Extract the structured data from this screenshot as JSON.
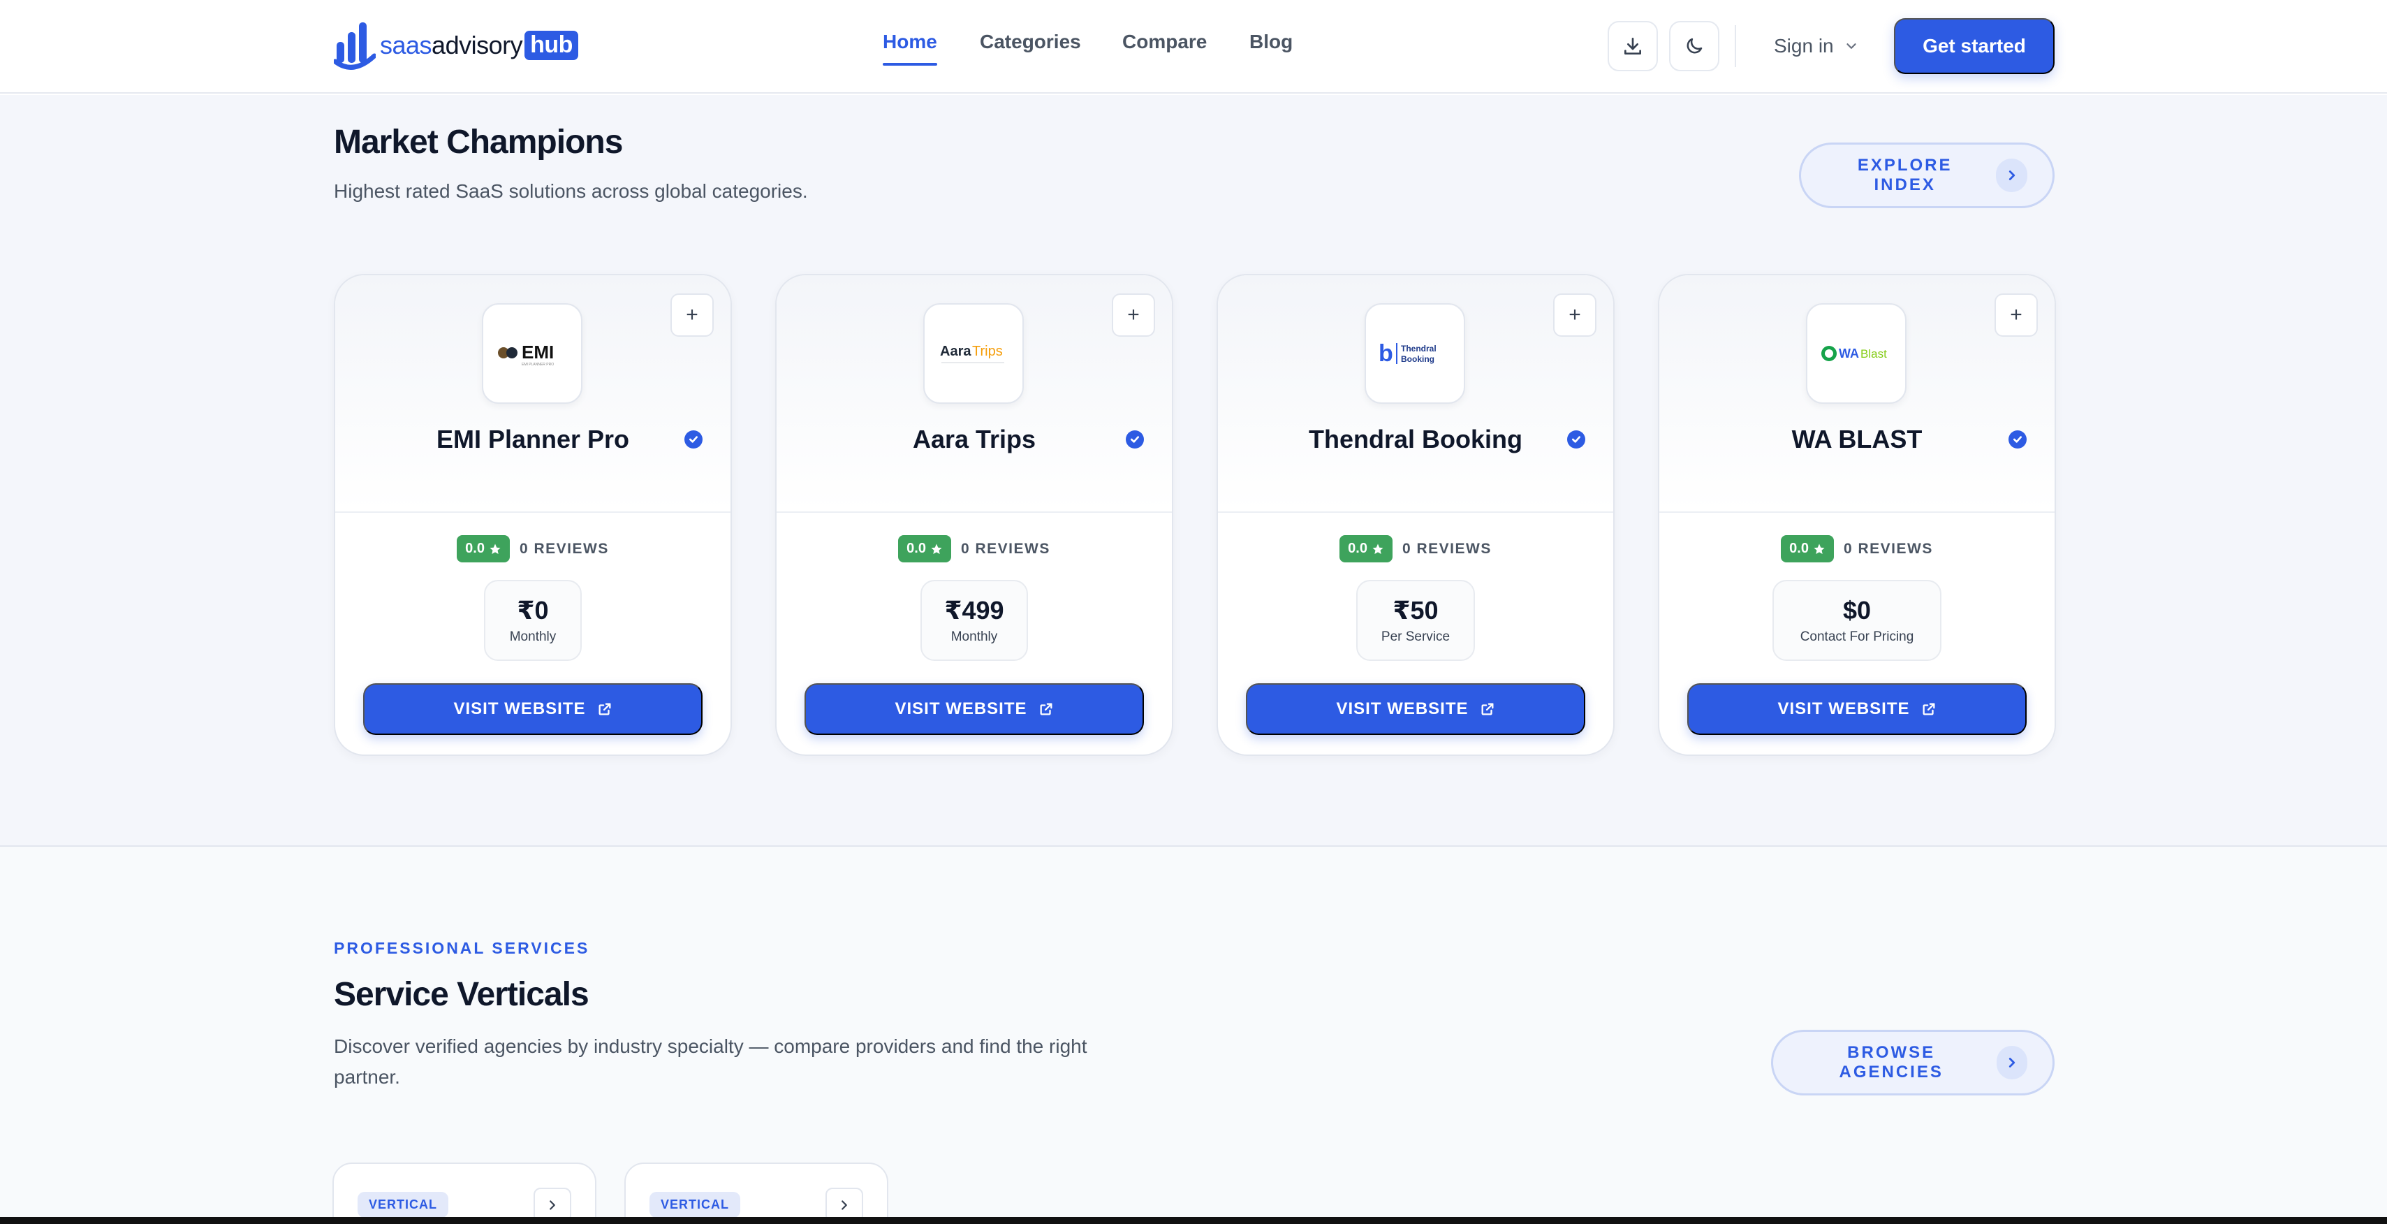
{
  "brand": {
    "part1": "saas",
    "part2": "advisory",
    "part3": "hub"
  },
  "nav": {
    "links": [
      {
        "label": "Home",
        "active": true
      },
      {
        "label": "Categories",
        "active": false
      },
      {
        "label": "Compare",
        "active": false
      },
      {
        "label": "Blog",
        "active": false
      }
    ],
    "signin": "Sign in",
    "cta": "Get started",
    "icons": [
      "download-icon",
      "moon-icon",
      "chevron-down-icon"
    ]
  },
  "champions": {
    "title": "Market Champions",
    "subtitle": "Highest rated SaaS solutions across global categories.",
    "explore": "EXPLORE INDEX",
    "cards": [
      {
        "name": "EMI Planner Pro",
        "logo_text": "EMI",
        "rating": "0.0",
        "reviews": "0 REVIEWS",
        "price": "₹0",
        "unit": "Monthly",
        "cta": "VISIT WEBSITE"
      },
      {
        "name": "Aara Trips",
        "logo_text": "Aara Trips",
        "rating": "0.0",
        "reviews": "0 REVIEWS",
        "price": "₹499",
        "unit": "Monthly",
        "cta": "VISIT WEBSITE"
      },
      {
        "name": "Thendral Booking",
        "logo_text": "Thendral Booking",
        "rating": "0.0",
        "reviews": "0 REVIEWS",
        "price": "₹50",
        "unit": "Per Service",
        "cta": "VISIT WEBSITE"
      },
      {
        "name": "WA BLAST",
        "logo_text": "WABlast",
        "rating": "0.0",
        "reviews": "0 REVIEWS",
        "price": "$0",
        "unit": "Contact For Pricing",
        "cta": "VISIT WEBSITE"
      }
    ],
    "add_label": "+"
  },
  "services": {
    "eyebrow": "PROFESSIONAL SERVICES",
    "title": "Service Verticals",
    "subtitle_line1": "Discover verified agencies by industry specialty — compare providers and find the right",
    "subtitle_line2": "partner.",
    "browse": "BROWSE AGENCIES",
    "verticals": [
      {
        "tag": "VERTICAL"
      },
      {
        "tag": "VERTICAL"
      }
    ]
  },
  "colors": {
    "accent": "#2d5be3",
    "rating_green": "#3ea35c",
    "page_bg": "#f4f6fb"
  }
}
